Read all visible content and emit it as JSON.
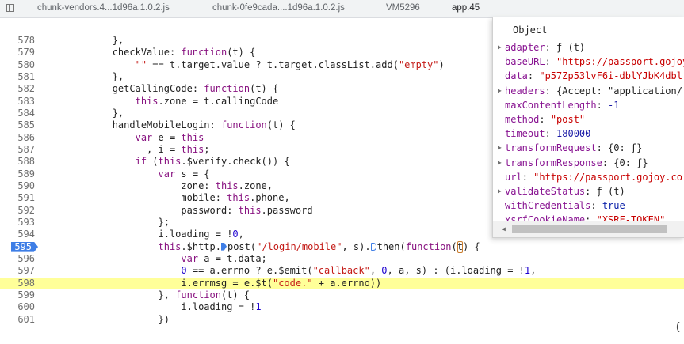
{
  "tabs": [
    {
      "label": "chunk-vendors.4...1d96a.1.0.2.js"
    },
    {
      "label": "chunk-0fe9cada....1d96a.1.0.2.js"
    },
    {
      "label": "VM5296"
    },
    {
      "label": "app.45"
    }
  ],
  "editor": {
    "lines": [
      {
        "n": "578",
        "html": "            },"
      },
      {
        "n": "579",
        "html": "            checkValue: <span class=\"kw\">function</span>(t) {"
      },
      {
        "n": "580",
        "html": "                <span class=\"str\">\"\"</span> == t.target.value ? t.target.classList.add(<span class=\"str\">\"empty\"</span>)"
      },
      {
        "n": "581",
        "html": "            },"
      },
      {
        "n": "582",
        "html": "            getCallingCode: <span class=\"kw\">function</span>(t) {"
      },
      {
        "n": "583",
        "html": "                <span class=\"kw\">this</span>.zone = t.callingCode"
      },
      {
        "n": "584",
        "html": "            },"
      },
      {
        "n": "585",
        "html": "            handleMobileLogin: <span class=\"kw\">function</span>(t) {"
      },
      {
        "n": "586",
        "html": "                <span class=\"kw\">var</span> e = <span class=\"kw\">this</span>"
      },
      {
        "n": "587",
        "html": "                  , i = <span class=\"kw\">this</span>;"
      },
      {
        "n": "588",
        "html": "                <span class=\"kw\">if</span> (<span class=\"kw\">this</span>.$verify.check()) {"
      },
      {
        "n": "589",
        "html": "                    <span class=\"kw\">var</span> s = {"
      },
      {
        "n": "590",
        "html": "                        zone: <span class=\"kw\">this</span>.zone,"
      },
      {
        "n": "591",
        "html": "                        mobile: <span class=\"kw\">this</span>.phone,"
      },
      {
        "n": "592",
        "html": "                        password: <span class=\"kw\">this</span>.password"
      },
      {
        "n": "593",
        "html": "                    };"
      },
      {
        "n": "594",
        "html": "                    i.loading = !<span class=\"num\">0</span>,"
      },
      {
        "n": "595",
        "html": "                    <span class=\"kw\">this</span>.$http.<span class=\"marker\"></span>post(<span class=\"str\">\"/login/mobile\"</span>, s).<span class=\"marker hollow\"></span>then(<span class=\"kw\">function</span>(<span class=\"tbox\">t</span>) {",
        "cls": "bp"
      },
      {
        "n": "596",
        "html": "                        <span class=\"kw\">var</span> a = t.data;"
      },
      {
        "n": "597",
        "html": "                        <span class=\"num\">0</span> == a.errno ? e.$emit(<span class=\"str\">\"callback\"</span>, <span class=\"num\">0</span>, a, s) : (i.loading = !<span class=\"num\">1</span>,"
      },
      {
        "n": "598",
        "html": "                        i.errmsg = e.$t(<span class=\"str\">\"code.\"</span> + a.errno))",
        "cls": "hl"
      },
      {
        "n": "599",
        "html": "                    }, <span class=\"kw\">function</span>(t) {"
      },
      {
        "n": "600",
        "html": "                        i.loading = !<span class=\"num\">1</span>"
      },
      {
        "n": "601",
        "html": "                    })"
      }
    ]
  },
  "popover": {
    "title": "Object",
    "props": [
      {
        "expand": true,
        "key": "adapter",
        "sep": ": ",
        "value": "ƒ (t)",
        "type": "obj"
      },
      {
        "expand": false,
        "key": "baseURL",
        "sep": ": ",
        "value": "\"https://passport.gojoy",
        "type": "str"
      },
      {
        "expand": false,
        "key": "data",
        "sep": ": ",
        "value": "\"p57Zp53lvF6i-dblYJbK4dbl",
        "type": "str"
      },
      {
        "expand": true,
        "key": "headers",
        "sep": ": ",
        "value": "{Accept: \"application/",
        "type": "obj"
      },
      {
        "expand": false,
        "key": "maxContentLength",
        "sep": ": ",
        "value": "-1",
        "type": "num"
      },
      {
        "expand": false,
        "key": "method",
        "sep": ": ",
        "value": "\"post\"",
        "type": "str"
      },
      {
        "expand": false,
        "key": "timeout",
        "sep": ": ",
        "value": "180000",
        "type": "num"
      },
      {
        "expand": true,
        "key": "transformRequest",
        "sep": ": ",
        "value": "{0: ƒ}",
        "type": "obj"
      },
      {
        "expand": true,
        "key": "transformResponse",
        "sep": ": ",
        "value": "{0: ƒ}",
        "type": "obj"
      },
      {
        "expand": false,
        "key": "url",
        "sep": ": ",
        "value": "\"https://passport.gojoy.co",
        "type": "str"
      },
      {
        "expand": true,
        "key": "validateStatus",
        "sep": ": ",
        "value": "ƒ (t)",
        "type": "obj"
      },
      {
        "expand": false,
        "key": "withCredentials",
        "sep": ": ",
        "value": "true",
        "type": "kw"
      },
      {
        "expand": false,
        "key": "xsrfCookieName",
        "sep": ": ",
        "value": "\"XSRF-TOKEN\"",
        "type": "str"
      }
    ]
  },
  "corner_glyph": "("
}
